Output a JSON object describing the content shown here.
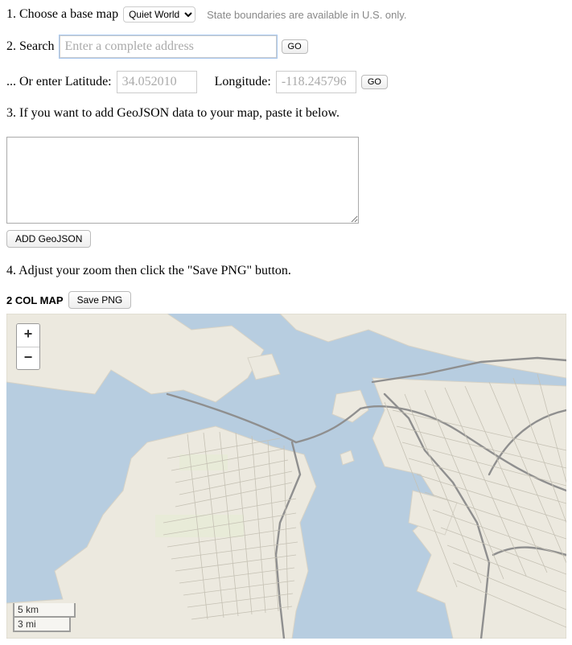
{
  "step1": {
    "label": "1. Choose a base map",
    "select_value": "Quiet World",
    "note": "State boundaries are available in U.S. only."
  },
  "step2": {
    "label": "2. Search",
    "placeholder": "Enter a complete address",
    "go_label": "GO",
    "or_label": "... Or enter Latitude:",
    "lat_placeholder": "34.052010",
    "lng_label": "Longitude:",
    "lng_placeholder": "-118.245796",
    "go2_label": "GO"
  },
  "step3": {
    "label": "3. If you want to add GeoJSON data to your map, paste it below.",
    "value": "",
    "add_label": "ADD GeoJSON"
  },
  "step4": {
    "label": "4. Adjust your zoom then click the \"Save PNG\" button."
  },
  "map_header": {
    "title": "2 COL MAP",
    "save_label": "Save PNG"
  },
  "map": {
    "zoom_in": "+",
    "zoom_out": "−",
    "scale_km": "5 km",
    "scale_mi": "3 mi"
  }
}
